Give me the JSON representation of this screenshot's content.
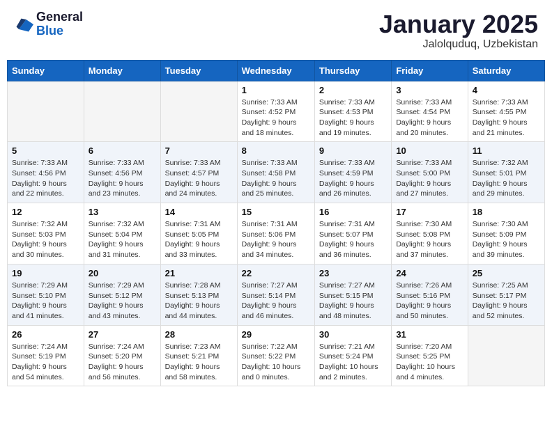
{
  "header": {
    "logo_general": "General",
    "logo_blue": "Blue",
    "month_title": "January 2025",
    "location": "Jalolquduq, Uzbekistan"
  },
  "weekdays": [
    "Sunday",
    "Monday",
    "Tuesday",
    "Wednesday",
    "Thursday",
    "Friday",
    "Saturday"
  ],
  "weeks": [
    [
      {
        "day": "",
        "sunrise": "",
        "sunset": "",
        "daylight": ""
      },
      {
        "day": "",
        "sunrise": "",
        "sunset": "",
        "daylight": ""
      },
      {
        "day": "",
        "sunrise": "",
        "sunset": "",
        "daylight": ""
      },
      {
        "day": "1",
        "sunrise": "Sunrise: 7:33 AM",
        "sunset": "Sunset: 4:52 PM",
        "daylight": "Daylight: 9 hours and 18 minutes."
      },
      {
        "day": "2",
        "sunrise": "Sunrise: 7:33 AM",
        "sunset": "Sunset: 4:53 PM",
        "daylight": "Daylight: 9 hours and 19 minutes."
      },
      {
        "day": "3",
        "sunrise": "Sunrise: 7:33 AM",
        "sunset": "Sunset: 4:54 PM",
        "daylight": "Daylight: 9 hours and 20 minutes."
      },
      {
        "day": "4",
        "sunrise": "Sunrise: 7:33 AM",
        "sunset": "Sunset: 4:55 PM",
        "daylight": "Daylight: 9 hours and 21 minutes."
      }
    ],
    [
      {
        "day": "5",
        "sunrise": "Sunrise: 7:33 AM",
        "sunset": "Sunset: 4:56 PM",
        "daylight": "Daylight: 9 hours and 22 minutes."
      },
      {
        "day": "6",
        "sunrise": "Sunrise: 7:33 AM",
        "sunset": "Sunset: 4:56 PM",
        "daylight": "Daylight: 9 hours and 23 minutes."
      },
      {
        "day": "7",
        "sunrise": "Sunrise: 7:33 AM",
        "sunset": "Sunset: 4:57 PM",
        "daylight": "Daylight: 9 hours and 24 minutes."
      },
      {
        "day": "8",
        "sunrise": "Sunrise: 7:33 AM",
        "sunset": "Sunset: 4:58 PM",
        "daylight": "Daylight: 9 hours and 25 minutes."
      },
      {
        "day": "9",
        "sunrise": "Sunrise: 7:33 AM",
        "sunset": "Sunset: 4:59 PM",
        "daylight": "Daylight: 9 hours and 26 minutes."
      },
      {
        "day": "10",
        "sunrise": "Sunrise: 7:33 AM",
        "sunset": "Sunset: 5:00 PM",
        "daylight": "Daylight: 9 hours and 27 minutes."
      },
      {
        "day": "11",
        "sunrise": "Sunrise: 7:32 AM",
        "sunset": "Sunset: 5:01 PM",
        "daylight": "Daylight: 9 hours and 29 minutes."
      }
    ],
    [
      {
        "day": "12",
        "sunrise": "Sunrise: 7:32 AM",
        "sunset": "Sunset: 5:03 PM",
        "daylight": "Daylight: 9 hours and 30 minutes."
      },
      {
        "day": "13",
        "sunrise": "Sunrise: 7:32 AM",
        "sunset": "Sunset: 5:04 PM",
        "daylight": "Daylight: 9 hours and 31 minutes."
      },
      {
        "day": "14",
        "sunrise": "Sunrise: 7:31 AM",
        "sunset": "Sunset: 5:05 PM",
        "daylight": "Daylight: 9 hours and 33 minutes."
      },
      {
        "day": "15",
        "sunrise": "Sunrise: 7:31 AM",
        "sunset": "Sunset: 5:06 PM",
        "daylight": "Daylight: 9 hours and 34 minutes."
      },
      {
        "day": "16",
        "sunrise": "Sunrise: 7:31 AM",
        "sunset": "Sunset: 5:07 PM",
        "daylight": "Daylight: 9 hours and 36 minutes."
      },
      {
        "day": "17",
        "sunrise": "Sunrise: 7:30 AM",
        "sunset": "Sunset: 5:08 PM",
        "daylight": "Daylight: 9 hours and 37 minutes."
      },
      {
        "day": "18",
        "sunrise": "Sunrise: 7:30 AM",
        "sunset": "Sunset: 5:09 PM",
        "daylight": "Daylight: 9 hours and 39 minutes."
      }
    ],
    [
      {
        "day": "19",
        "sunrise": "Sunrise: 7:29 AM",
        "sunset": "Sunset: 5:10 PM",
        "daylight": "Daylight: 9 hours and 41 minutes."
      },
      {
        "day": "20",
        "sunrise": "Sunrise: 7:29 AM",
        "sunset": "Sunset: 5:12 PM",
        "daylight": "Daylight: 9 hours and 43 minutes."
      },
      {
        "day": "21",
        "sunrise": "Sunrise: 7:28 AM",
        "sunset": "Sunset: 5:13 PM",
        "daylight": "Daylight: 9 hours and 44 minutes."
      },
      {
        "day": "22",
        "sunrise": "Sunrise: 7:27 AM",
        "sunset": "Sunset: 5:14 PM",
        "daylight": "Daylight: 9 hours and 46 minutes."
      },
      {
        "day": "23",
        "sunrise": "Sunrise: 7:27 AM",
        "sunset": "Sunset: 5:15 PM",
        "daylight": "Daylight: 9 hours and 48 minutes."
      },
      {
        "day": "24",
        "sunrise": "Sunrise: 7:26 AM",
        "sunset": "Sunset: 5:16 PM",
        "daylight": "Daylight: 9 hours and 50 minutes."
      },
      {
        "day": "25",
        "sunrise": "Sunrise: 7:25 AM",
        "sunset": "Sunset: 5:17 PM",
        "daylight": "Daylight: 9 hours and 52 minutes."
      }
    ],
    [
      {
        "day": "26",
        "sunrise": "Sunrise: 7:24 AM",
        "sunset": "Sunset: 5:19 PM",
        "daylight": "Daylight: 9 hours and 54 minutes."
      },
      {
        "day": "27",
        "sunrise": "Sunrise: 7:24 AM",
        "sunset": "Sunset: 5:20 PM",
        "daylight": "Daylight: 9 hours and 56 minutes."
      },
      {
        "day": "28",
        "sunrise": "Sunrise: 7:23 AM",
        "sunset": "Sunset: 5:21 PM",
        "daylight": "Daylight: 9 hours and 58 minutes."
      },
      {
        "day": "29",
        "sunrise": "Sunrise: 7:22 AM",
        "sunset": "Sunset: 5:22 PM",
        "daylight": "Daylight: 10 hours and 0 minutes."
      },
      {
        "day": "30",
        "sunrise": "Sunrise: 7:21 AM",
        "sunset": "Sunset: 5:24 PM",
        "daylight": "Daylight: 10 hours and 2 minutes."
      },
      {
        "day": "31",
        "sunrise": "Sunrise: 7:20 AM",
        "sunset": "Sunset: 5:25 PM",
        "daylight": "Daylight: 10 hours and 4 minutes."
      },
      {
        "day": "",
        "sunrise": "",
        "sunset": "",
        "daylight": ""
      }
    ]
  ]
}
